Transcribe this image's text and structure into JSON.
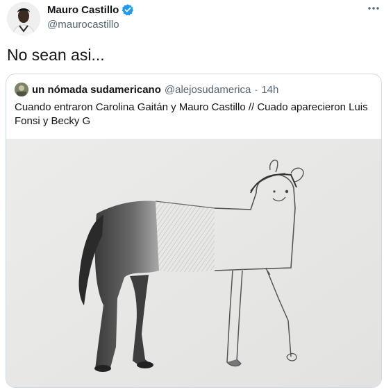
{
  "author": {
    "display_name": "Mauro Castillo",
    "handle": "@maurocastillo",
    "verified_icon": "verified-badge-icon",
    "badge_color": "#1d9bf0"
  },
  "tweet": {
    "text": "No sean asi..."
  },
  "quoted": {
    "display_name": "un nómada sudamericano",
    "handle": "@alejosudamerica",
    "separator": "·",
    "time": "14h",
    "text": "Cuando entraron Carolina Gaitán y Mauro Castillo // Cuado aparecieron Luis Fonsi y Becky G"
  },
  "icons": {
    "more": "more-icon"
  }
}
